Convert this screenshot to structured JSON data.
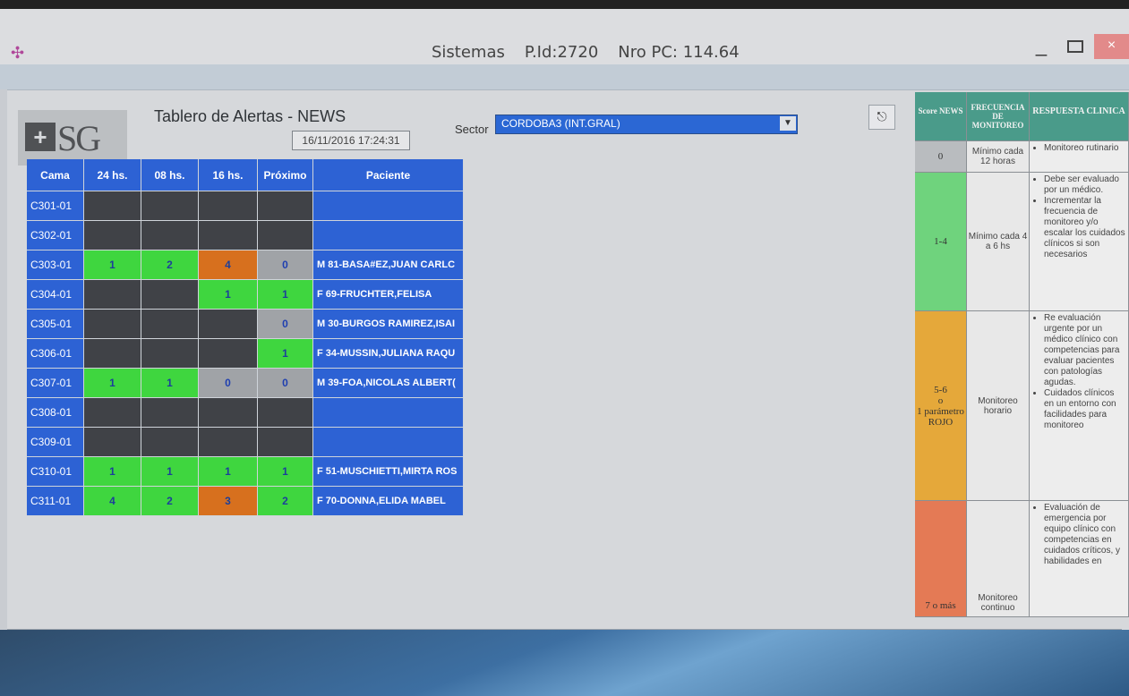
{
  "window": {
    "title_app": "Sistemas",
    "title_pid": "P.Id:2720",
    "title_pc": "Nro PC: 114.64",
    "minimize_label": "_",
    "close_label": "×"
  },
  "header": {
    "logo_letters": "SG",
    "title": "Tablero de Alertas - NEWS",
    "datetime": "16/11/2016 17:24:31",
    "sector_label": "Sector",
    "sector_value": "CORDOBA3 (INT.GRAL)"
  },
  "colors": {
    "green": "#3fd63f",
    "orange": "#d7701e",
    "gray": "#a0a3a7",
    "empty": "#404247",
    "blue": "#2d62d4"
  },
  "grid": {
    "columns": [
      "Cama",
      "24 hs.",
      "08 hs.",
      "16 hs.",
      "Próximo",
      "Paciente"
    ],
    "rows": [
      {
        "bed": "C301-01",
        "cells": [
          {
            "v": "",
            "c": "empty"
          },
          {
            "v": "",
            "c": "empty"
          },
          {
            "v": "",
            "c": "empty"
          },
          {
            "v": "",
            "c": "empty"
          }
        ],
        "patient": ""
      },
      {
        "bed": "C302-01",
        "cells": [
          {
            "v": "",
            "c": "empty"
          },
          {
            "v": "",
            "c": "empty"
          },
          {
            "v": "",
            "c": "empty"
          },
          {
            "v": "",
            "c": "empty"
          }
        ],
        "patient": ""
      },
      {
        "bed": "C303-01",
        "cells": [
          {
            "v": "1",
            "c": "green"
          },
          {
            "v": "2",
            "c": "green"
          },
          {
            "v": "4",
            "c": "orange"
          },
          {
            "v": "0",
            "c": "gray"
          }
        ],
        "patient": "M 81-BASA#EZ,JUAN CARLC"
      },
      {
        "bed": "C304-01",
        "cells": [
          {
            "v": "",
            "c": "empty"
          },
          {
            "v": "",
            "c": "empty"
          },
          {
            "v": "1",
            "c": "green"
          },
          {
            "v": "1",
            "c": "green"
          }
        ],
        "patient": "F 69-FRUCHTER,FELISA"
      },
      {
        "bed": "C305-01",
        "cells": [
          {
            "v": "",
            "c": "empty"
          },
          {
            "v": "",
            "c": "empty"
          },
          {
            "v": "",
            "c": "empty"
          },
          {
            "v": "0",
            "c": "gray"
          }
        ],
        "patient": "M 30-BURGOS RAMIREZ,ISAI"
      },
      {
        "bed": "C306-01",
        "cells": [
          {
            "v": "",
            "c": "empty"
          },
          {
            "v": "",
            "c": "empty"
          },
          {
            "v": "",
            "c": "empty"
          },
          {
            "v": "1",
            "c": "green"
          }
        ],
        "patient": "F 34-MUSSIN,JULIANA RAQU"
      },
      {
        "bed": "C307-01",
        "cells": [
          {
            "v": "1",
            "c": "green"
          },
          {
            "v": "1",
            "c": "green"
          },
          {
            "v": "0",
            "c": "gray"
          },
          {
            "v": "0",
            "c": "gray"
          }
        ],
        "patient": "M 39-FOA,NICOLAS ALBERT("
      },
      {
        "bed": "C308-01",
        "cells": [
          {
            "v": "",
            "c": "empty"
          },
          {
            "v": "",
            "c": "empty"
          },
          {
            "v": "",
            "c": "empty"
          },
          {
            "v": "",
            "c": "empty"
          }
        ],
        "patient": ""
      },
      {
        "bed": "C309-01",
        "cells": [
          {
            "v": "",
            "c": "empty"
          },
          {
            "v": "",
            "c": "empty"
          },
          {
            "v": "",
            "c": "empty"
          },
          {
            "v": "",
            "c": "empty"
          }
        ],
        "patient": ""
      },
      {
        "bed": "C310-01",
        "cells": [
          {
            "v": "1",
            "c": "green"
          },
          {
            "v": "1",
            "c": "green"
          },
          {
            "v": "1",
            "c": "green"
          },
          {
            "v": "1",
            "c": "green"
          }
        ],
        "patient": "F 51-MUSCHIETTI,MIRTA ROS"
      },
      {
        "bed": "C311-01",
        "cells": [
          {
            "v": "4",
            "c": "green"
          },
          {
            "v": "2",
            "c": "green"
          },
          {
            "v": "3",
            "c": "orange"
          },
          {
            "v": "2",
            "c": "green"
          }
        ],
        "patient": "F 70-DONNA,ELIDA MABEL"
      }
    ]
  },
  "news_table": {
    "headers": {
      "score": "Score NEWS",
      "freq": "FRECUENCIA DE MONITOREO",
      "resp": "RESPUESTA CLINICA"
    },
    "rows": [
      {
        "score": "0",
        "color": "#b9bcbf",
        "freq": "Mínimo cada 12 horas",
        "resp": [
          "Monitoreo rutinario"
        ]
      },
      {
        "score": "1-4",
        "color": "#6fd37d",
        "freq": "Mínimo cada 4 a 6 hs",
        "resp": [
          "Debe ser evaluado por un médico.",
          "Incrementar la frecuencia de monitoreo y/o escalar los cuidados clínicos si son necesarios"
        ]
      },
      {
        "score": "5-6\no\n1 parámetro\nROJO",
        "color": "#e5a83a",
        "freq": "Monitoreo horario",
        "resp": [
          "Re evaluación urgente por un médico clínico con competencias para evaluar pacientes con patologías agudas.",
          "Cuidados clínicos en un entorno con facilidades para monitoreo"
        ]
      },
      {
        "score": "7 o más",
        "color": "#e47a55",
        "freq": "Monitoreo continuo",
        "resp": [
          "Evaluación de emergencia por equipo clínico con competencias en cuidados críticos, y habilidades en"
        ]
      }
    ]
  }
}
